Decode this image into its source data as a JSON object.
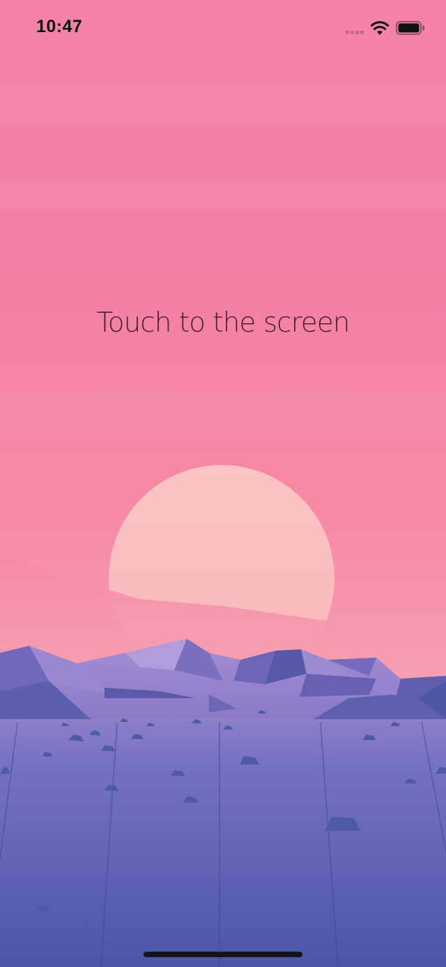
{
  "status_bar": {
    "time": "10:47",
    "signal_icon": "signal-bars-icon",
    "wifi_icon": "wifi-icon",
    "battery_icon": "battery-icon"
  },
  "main": {
    "prompt": "Touch to the screen"
  },
  "colors": {
    "sky_top": "#f67fa5",
    "sky_bottom": "#f7a0b2",
    "sun": "#fbc6c3",
    "mountains": "#8a7fca",
    "ground": "#5a5fb3",
    "prompt_text": "#4b2233"
  }
}
